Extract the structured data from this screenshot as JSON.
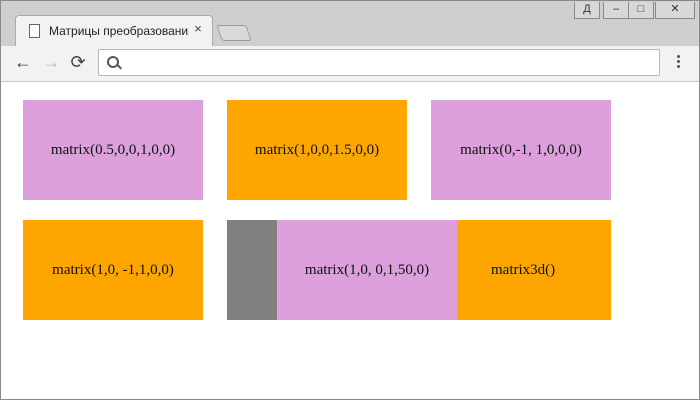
{
  "browser": {
    "tab_title": "Матрицы преобразований",
    "tab_close": "×",
    "user_button": "Д",
    "minimize": "–",
    "maximize": "□",
    "close": "✕",
    "back": "←",
    "forward": "→",
    "reload": "⟳",
    "address": "",
    "address_placeholder": ""
  },
  "boxes": [
    {
      "label": "matrix(0.5,0,0,1,0,0)",
      "color": "#dda0dd"
    },
    {
      "label": "matrix(1,0,0,1.5,0,0)",
      "color": "#ffa500"
    },
    {
      "label": "matrix(0,-1, 1,0,0,0)",
      "color": "#dda0dd"
    },
    {
      "label": "matrix(1,0, -1,1,0,0)",
      "color": "#ffa500"
    },
    {
      "label": "",
      "color": "#808080"
    },
    {
      "label": "matrix(1,0, 0,1,50,0)",
      "color": "#dda0dd"
    },
    {
      "label": "matrix3d()",
      "color": "#ffa500"
    }
  ]
}
